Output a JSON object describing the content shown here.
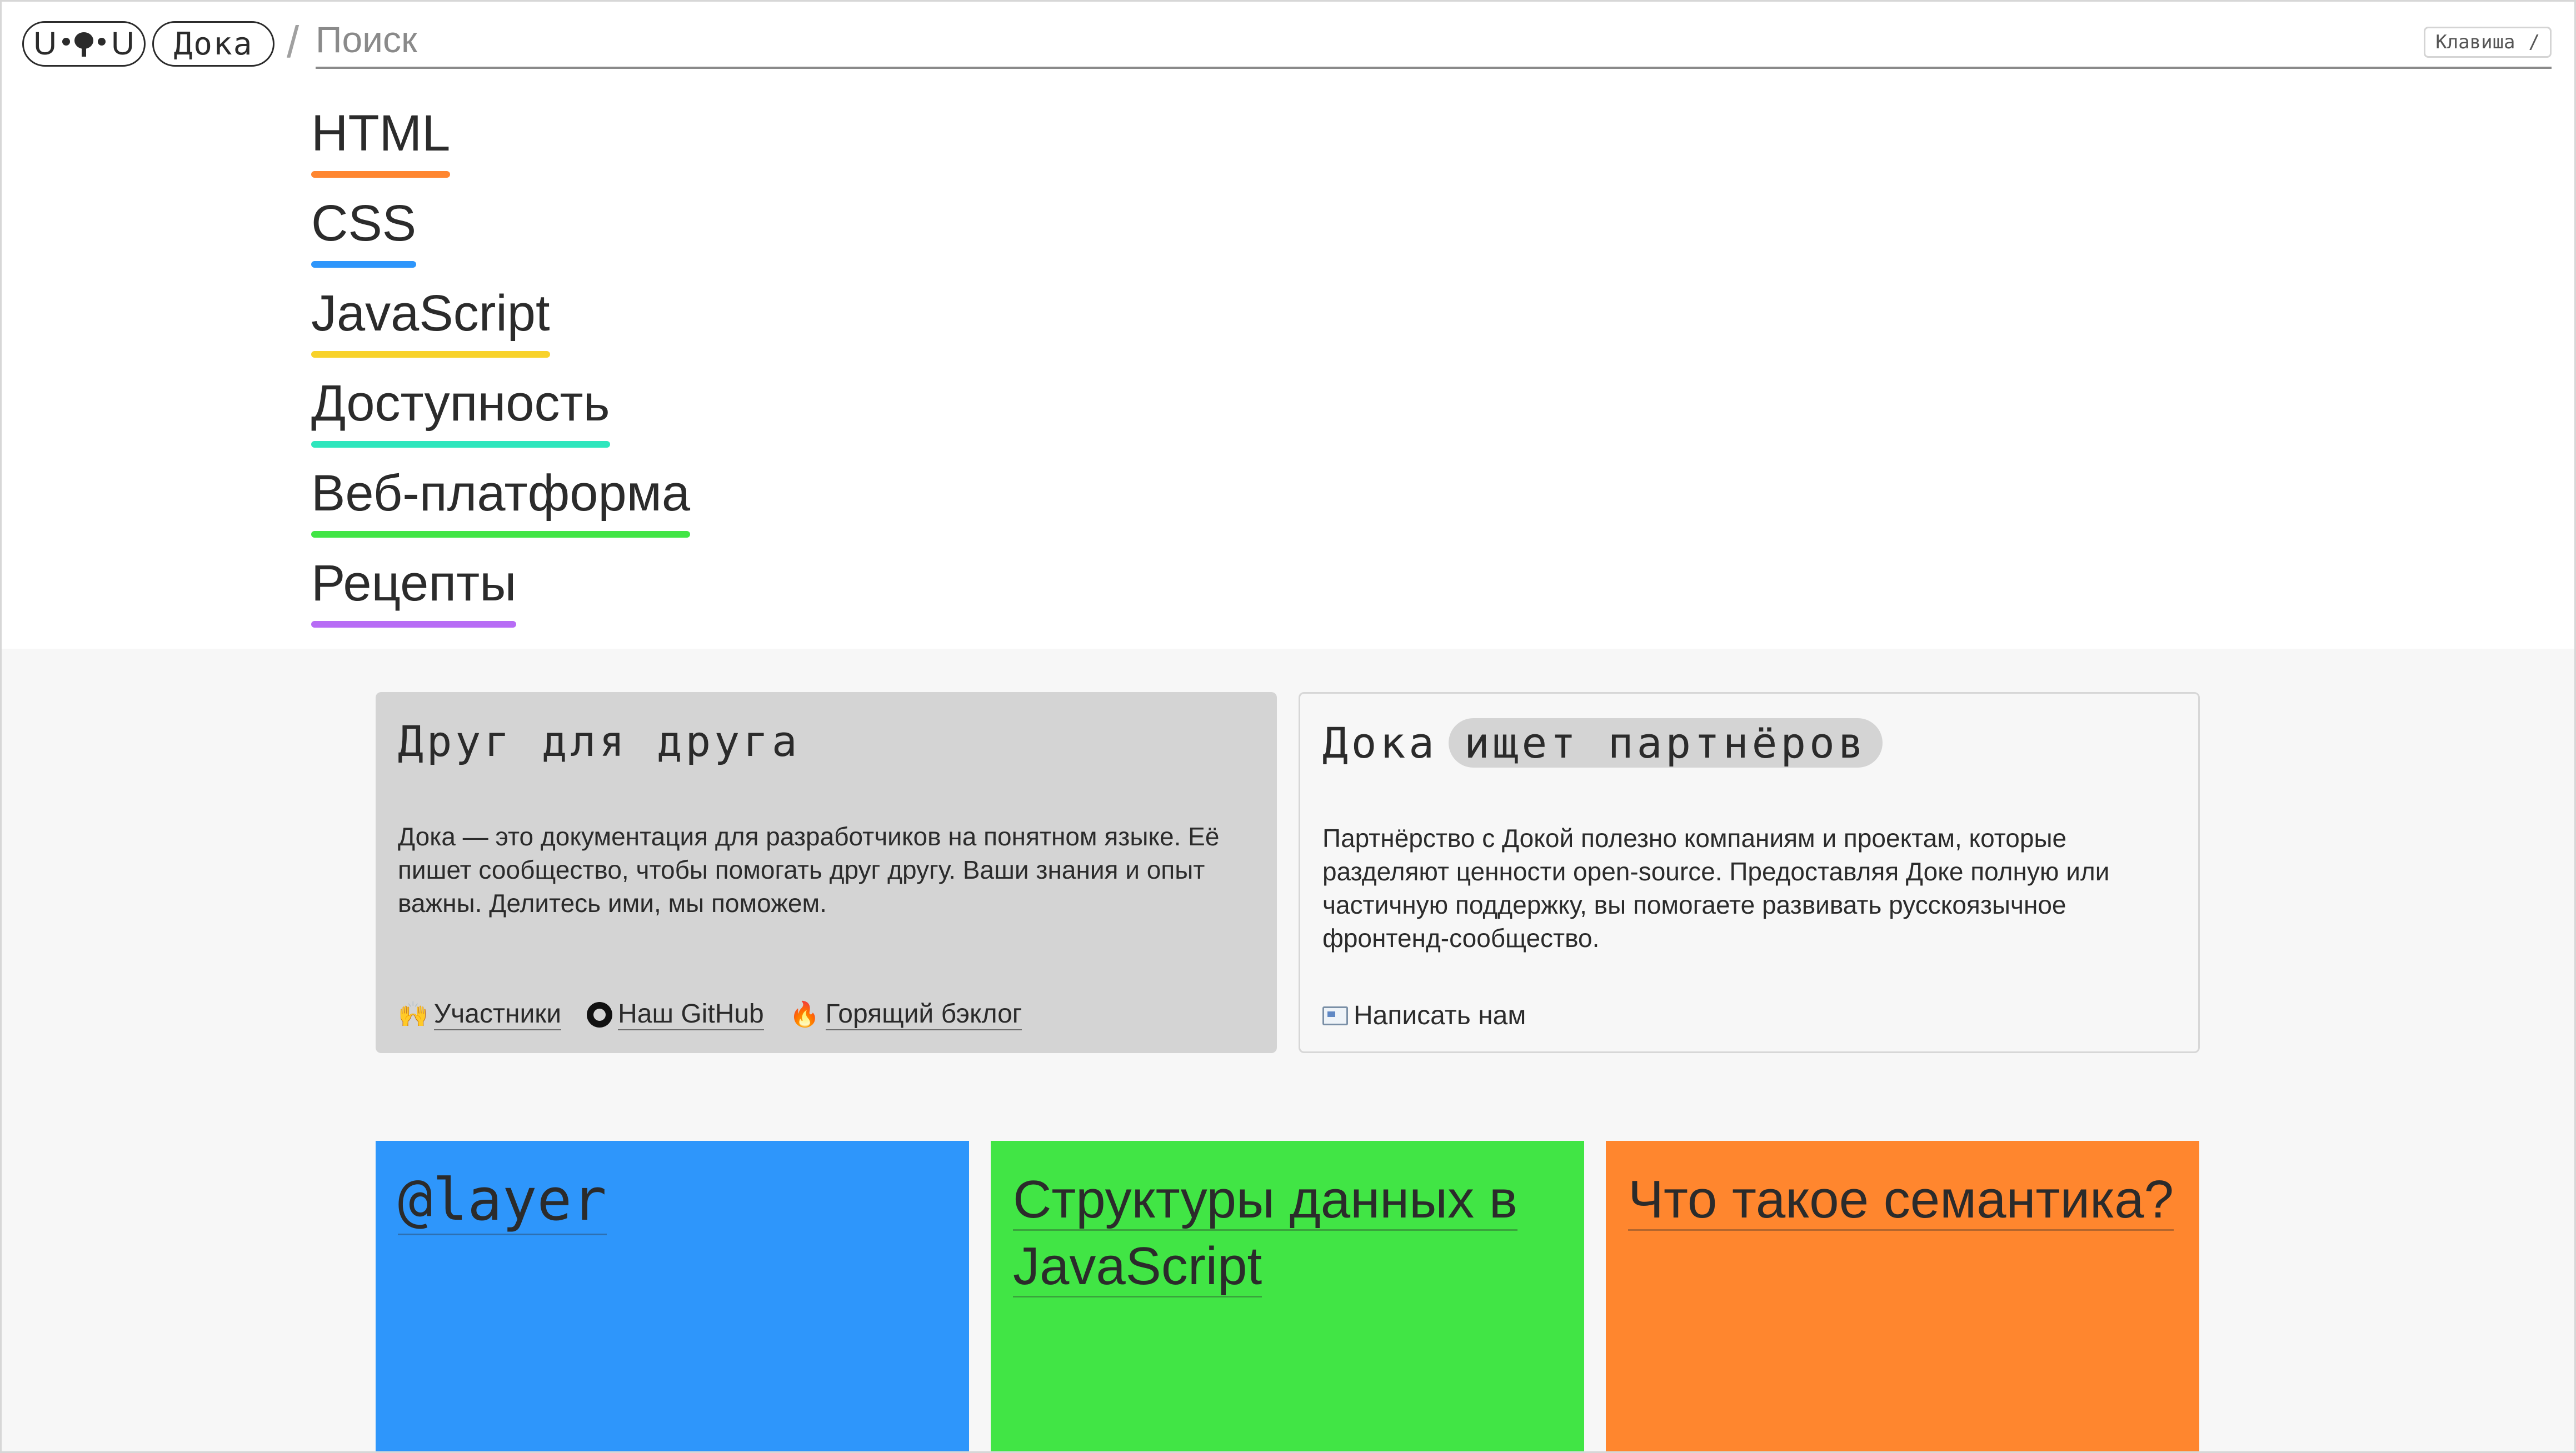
{
  "header": {
    "logo_face_left": "U",
    "logo_face_right": "U",
    "brand": "Дока",
    "separator": "/",
    "search_placeholder": "Поиск",
    "shortcut_label": "Клавиша",
    "shortcut_key": "/"
  },
  "nav": {
    "items": [
      {
        "label": "HTML",
        "color": "#ff8630"
      },
      {
        "label": "CSS",
        "color": "#2e96fb"
      },
      {
        "label": "JavaScript",
        "color": "#f8d22a"
      },
      {
        "label": "Доступность",
        "color": "#2ee6bd"
      },
      {
        "label": "Веб-платформа",
        "color": "#41e545"
      },
      {
        "label": "Рецепты",
        "color": "#b76cf5"
      }
    ]
  },
  "friend_card": {
    "title": "Друг для друга",
    "text": "Дока — это документация для разработчиков на понятном языке. Её пишет сообщество, чтобы помогать друг другу. Ваши знания и опыт важны. Делитесь ими, мы поможем.",
    "links": [
      {
        "emoji": "🙌",
        "label": "Участники"
      },
      {
        "icon": "github-icon",
        "label": "Наш GitHub"
      },
      {
        "emoji": "🔥",
        "label": "Горящий бэклог"
      }
    ]
  },
  "partner_card": {
    "title_prefix": "Дока",
    "title_highlight": "ищет партнёров",
    "text": "Партнёрство с Докой полезно компаниям и проектам, которые разделяют ценности open-source. Предоставляя Доке полную или частичную поддержку, вы помогаете развивать русскоязычное фронтенд-сообщество.",
    "link_label": "Написать нам",
    "link_icon": "mail-icon"
  },
  "tiles": [
    {
      "title": "@layer",
      "color": "#2e96fb"
    },
    {
      "title": "Структуры данных в JavaScript",
      "color": "#41e545"
    },
    {
      "title": "Что такое семантика?",
      "color": "#ff862e"
    }
  ]
}
